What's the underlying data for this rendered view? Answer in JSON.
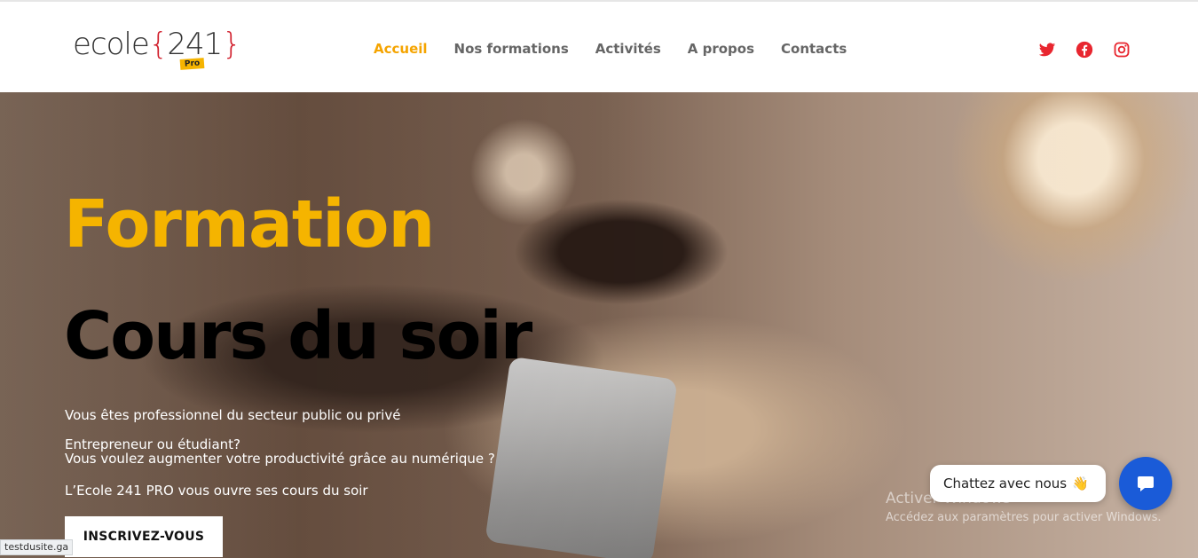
{
  "header": {
    "logo": {
      "word": "ecole",
      "number": "241",
      "badge": "Pro"
    },
    "nav": [
      {
        "label": "Accueil",
        "active": true
      },
      {
        "label": "Nos formations",
        "active": false
      },
      {
        "label": "Activités",
        "active": false
      },
      {
        "label": "A propos",
        "active": false
      },
      {
        "label": "Contacts",
        "active": false
      }
    ],
    "social": [
      "twitter-icon",
      "facebook-icon",
      "instagram-icon"
    ],
    "social_color": "#e8262f"
  },
  "hero": {
    "title_accent": "Formation",
    "title_main": "Cours du soir",
    "lines": [
      "Vous êtes professionnel du secteur public ou privé",
      "Entrepreneur ou étudiant?",
      "Vous voulez augmenter votre productivité grâce au numérique ?",
      "L’Ecole 241 PRO vous ouvre ses cours du soir"
    ],
    "cta_label": "INSCRIVEZ-VOUS",
    "accent_color": "#f5b400"
  },
  "chat": {
    "bubble_text": "Chattez avec nous",
    "emoji": "👋",
    "button_color": "#1a5bd8"
  },
  "windows_watermark": {
    "title": "Activer Windows",
    "subtitle": "Accédez aux paramètres pour activer Windows."
  },
  "status_bar": {
    "url": "testdusite.ga"
  }
}
